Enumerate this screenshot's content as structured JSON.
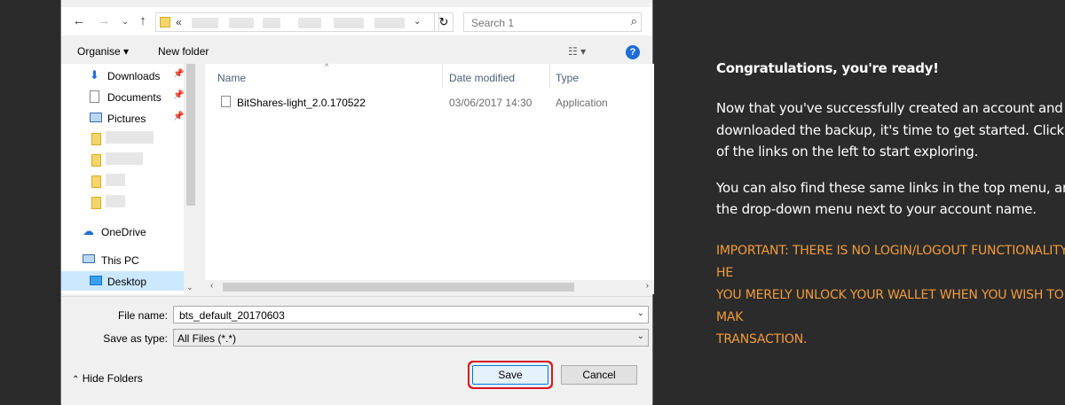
{
  "dialog": {
    "address": {
      "chevron": "«"
    },
    "search": {
      "placeholder": "Search 1"
    },
    "toolbar": {
      "organise": "Organise ▾",
      "new_folder": "New folder",
      "view_icon": "view-icon",
      "help_icon": "help-icon"
    },
    "nav": [
      {
        "label": "Downloads",
        "icon": "downloads-icon",
        "pinned": true
      },
      {
        "label": "Documents",
        "icon": "documents-icon",
        "pinned": true
      },
      {
        "label": "Pictures",
        "icon": "pictures-icon",
        "pinned": true
      },
      {
        "label": "OneDrive",
        "icon": "onedrive-icon"
      },
      {
        "label": "This PC",
        "icon": "this-pc-icon"
      },
      {
        "label": "Desktop",
        "icon": "desktop-icon",
        "selected": true
      }
    ],
    "columns": {
      "name": "Name",
      "date": "Date modified",
      "type": "Type"
    },
    "files": [
      {
        "name": "BitShares-light_2.0.170522",
        "date": "03/06/2017 14:30",
        "type": "Application"
      }
    ],
    "file_name_label": "File name:",
    "file_name_value": "bts_default_20170603",
    "save_type_label": "Save as type:",
    "save_type_value": "All Files (*.*)",
    "hide_folders": "Hide Folders",
    "save_button": "Save",
    "cancel_button": "Cancel"
  },
  "panel": {
    "title": "Congratulations, you're ready!",
    "p1_line1": "Now that you've successfully created an account and",
    "p1_line2": "downloaded the backup, it's time to get started. Click o",
    "p1_line3": "of the links on the left to start exploring.",
    "p2_line1": "You can also find these same links in the top menu, and",
    "p2_line2": "the drop-down menu next to your account name.",
    "important_line1": "IMPORTANT: THERE IS NO LOGIN/LOGOUT FUNCTIONALITY HE",
    "important_line2": "YOU MERELY UNLOCK YOUR WALLET WHEN YOU WISH TO MAK",
    "important_line3": "TRANSACTION."
  },
  "colors": {
    "accent": "#f29b3b",
    "highlight": "#d9151b",
    "selection": "#cce8ff"
  }
}
